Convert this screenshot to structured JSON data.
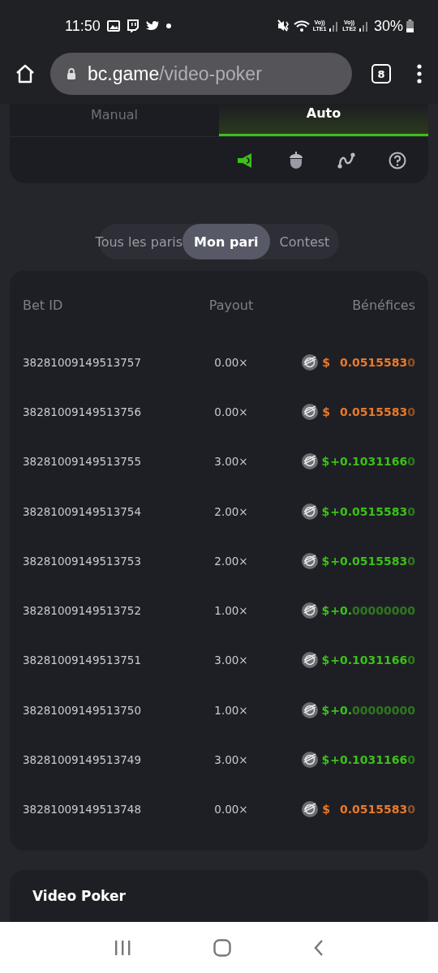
{
  "status_bar": {
    "time": "11:50",
    "sim_labels": [
      {
        "top": "Vo))",
        "bottom": "LTE1"
      },
      {
        "top": "Vo))",
        "bottom": "LTE2"
      }
    ],
    "battery": "30%"
  },
  "browser": {
    "domain": "bc.game",
    "path": "/video-poker",
    "tab_count": "8"
  },
  "mode_tabs": [
    {
      "label": "Manual",
      "selected": false
    },
    {
      "label": "Auto",
      "selected": true
    }
  ],
  "tool_icons": [
    {
      "kind": "sound",
      "active": true
    },
    {
      "kind": "acorn",
      "active": false
    },
    {
      "kind": "curve",
      "active": false
    },
    {
      "kind": "help",
      "active": false
    }
  ],
  "bet_tabs": [
    {
      "label": "Tous les paris",
      "selected": false
    },
    {
      "label": "Mon pari",
      "selected": true
    },
    {
      "label": "Contest",
      "selected": false
    }
  ],
  "table": {
    "columns": [
      "Bet ID",
      "Payout",
      "Bénéfices"
    ],
    "rows": [
      {
        "bet_id": "38281009149513757",
        "payout": "0.00×",
        "kind": "loss",
        "symbol": "$",
        "amount": "0.0515583",
        "tail": "0"
      },
      {
        "bet_id": "38281009149513756",
        "payout": "0.00×",
        "kind": "loss",
        "symbol": "$",
        "amount": "0.0515583",
        "tail": "0"
      },
      {
        "bet_id": "38281009149513755",
        "payout": "3.00×",
        "kind": "win",
        "symbol": "$",
        "amount": "+0.1031166",
        "tail": "0"
      },
      {
        "bet_id": "38281009149513754",
        "payout": "2.00×",
        "kind": "win",
        "symbol": "$",
        "amount": "+0.0515583",
        "tail": "0"
      },
      {
        "bet_id": "38281009149513753",
        "payout": "2.00×",
        "kind": "win",
        "symbol": "$",
        "amount": "+0.0515583",
        "tail": "0"
      },
      {
        "bet_id": "38281009149513752",
        "payout": "1.00×",
        "kind": "win",
        "symbol": "$",
        "amount": "+0.",
        "tail": "00000000"
      },
      {
        "bet_id": "38281009149513751",
        "payout": "3.00×",
        "kind": "win",
        "symbol": "$",
        "amount": "+0.1031166",
        "tail": "0"
      },
      {
        "bet_id": "38281009149513750",
        "payout": "1.00×",
        "kind": "win",
        "symbol": "$",
        "amount": "+0.",
        "tail": "00000000"
      },
      {
        "bet_id": "38281009149513749",
        "payout": "3.00×",
        "kind": "win",
        "symbol": "$",
        "amount": "+0.1031166",
        "tail": "0"
      },
      {
        "bet_id": "38281009149513748",
        "payout": "0.00×",
        "kind": "loss",
        "symbol": "$",
        "amount": "0.0515583",
        "tail": "0"
      }
    ]
  },
  "game_card": {
    "title": "Video Poker"
  }
}
